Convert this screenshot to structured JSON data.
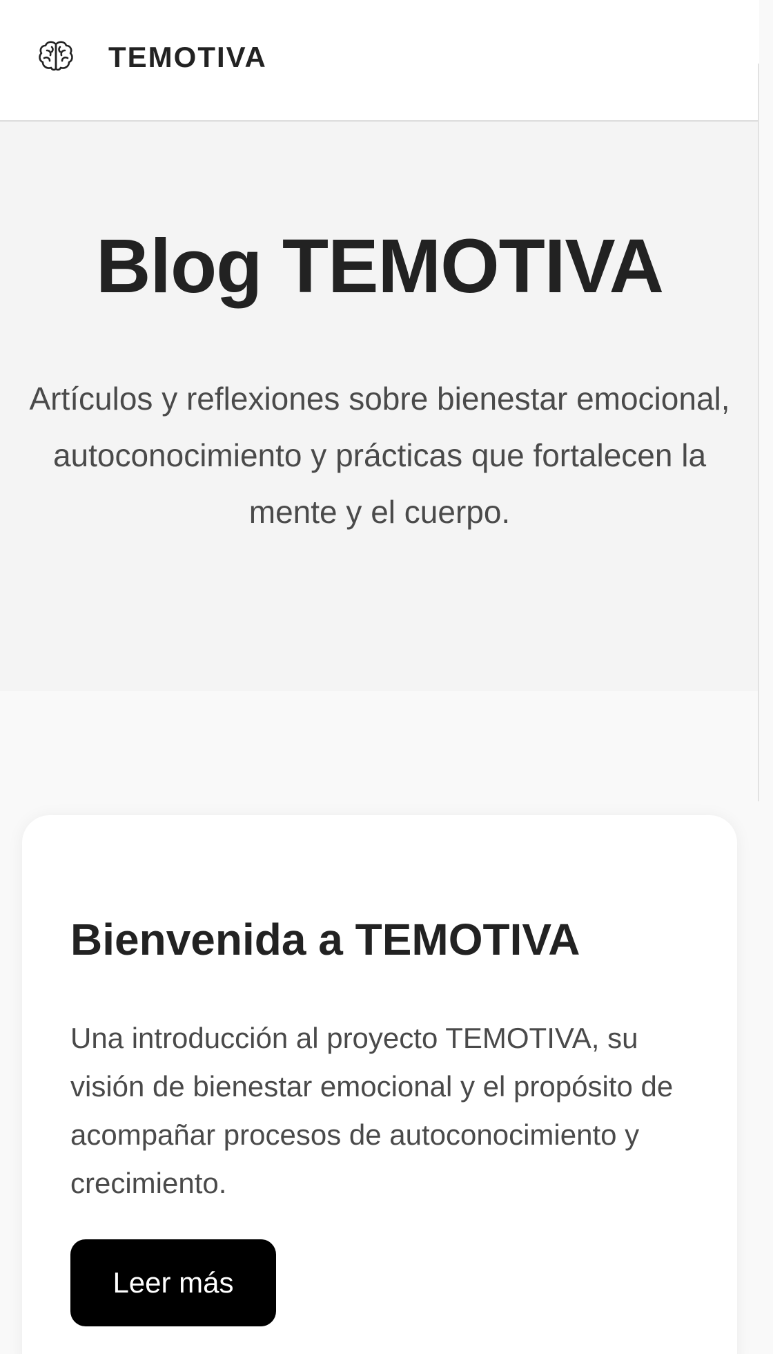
{
  "header": {
    "brand": "TEMOTIVA",
    "logo_icon": "brain-icon"
  },
  "hero": {
    "title": "Blog TEMOTIVA",
    "subtitle": "Artículos y reflexiones sobre bienestar emocional, autoconocimiento y prácticas que fortalecen la mente y el cuerpo."
  },
  "posts": [
    {
      "title": "Bienvenida a TEMOTIVA",
      "excerpt": "Una introducción al proyecto TEMOTIVA, su visión de bienestar emocional y el propósito de acompañar procesos de autoconocimiento y crecimiento.",
      "cta_label": "Leer más"
    }
  ],
  "colors": {
    "header_bg": "#ffffff",
    "hero_bg": "#f4f4f4",
    "page_bg": "#f9f9f9",
    "text_primary": "#222222",
    "text_secondary": "#4a4a4a",
    "button_bg": "#000000",
    "button_text": "#ffffff"
  }
}
